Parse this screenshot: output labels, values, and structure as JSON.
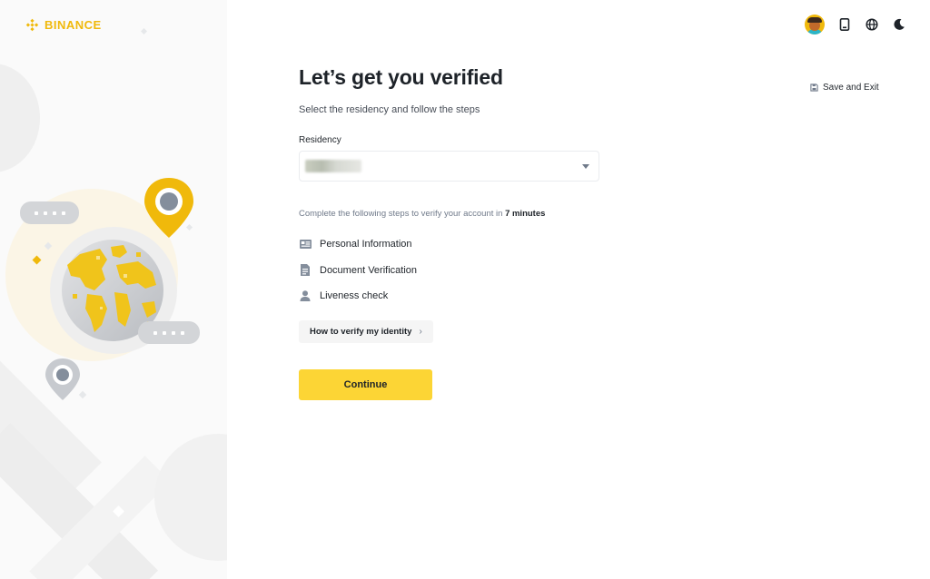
{
  "brand": {
    "name": "BINANCE",
    "color": "#f0b90b"
  },
  "header": {
    "icons": [
      "avatar",
      "mobile-download-icon",
      "globe-icon",
      "moon-icon"
    ],
    "save_exit_label": "Save and Exit"
  },
  "main": {
    "title": "Let’s get you verified",
    "subtitle": "Select the residency and follow the steps",
    "residency_label": "Residency",
    "residency_value": "",
    "complete_prefix": "Complete the following steps to verify your account in",
    "complete_time": "7 minutes",
    "steps": [
      {
        "label": "Personal Information",
        "icon": "id-card-icon"
      },
      {
        "label": "Document Verification",
        "icon": "document-icon"
      },
      {
        "label": "Liveness check",
        "icon": "person-icon"
      }
    ],
    "howto_label": "How to verify my identity",
    "continue_label": "Continue"
  },
  "colors": {
    "accent": "#fcd535",
    "brand_yellow": "#f0b90b",
    "text_primary": "#1e2329",
    "text_secondary": "#707a8a"
  }
}
